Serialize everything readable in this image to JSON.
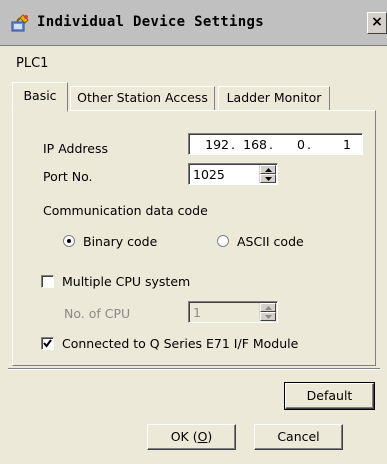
{
  "window": {
    "title": "Individual Device Settings",
    "close_glyph": "×",
    "icon": "device-settings-icon"
  },
  "device_name": "PLC1",
  "tabs": [
    {
      "label": "Basic",
      "active": true
    },
    {
      "label": "Other Station Access",
      "active": false
    },
    {
      "label": "Ladder Monitor",
      "active": false
    }
  ],
  "basic": {
    "ip_label": "IP Address",
    "ip": [
      "192",
      "168",
      "0",
      "1"
    ],
    "port_label": "Port No.",
    "port_value": "1025",
    "comm_code_label": "Communication data code",
    "binary_label": "Binary code",
    "ascii_label": "ASCII code",
    "selected_code": "Binary code",
    "multi_cpu_label": "Multiple CPU system",
    "multi_cpu_checked": false,
    "num_cpu_label": "No. of CPU",
    "num_cpu_value": "1",
    "q_series_label": "Connected to Q Series E71 I/F Module",
    "q_series_checked": true
  },
  "buttons": {
    "default": "Default",
    "ok_prefix": "OK (",
    "ok_mnemonic": "O",
    "ok_suffix": ")",
    "cancel": "Cancel"
  }
}
